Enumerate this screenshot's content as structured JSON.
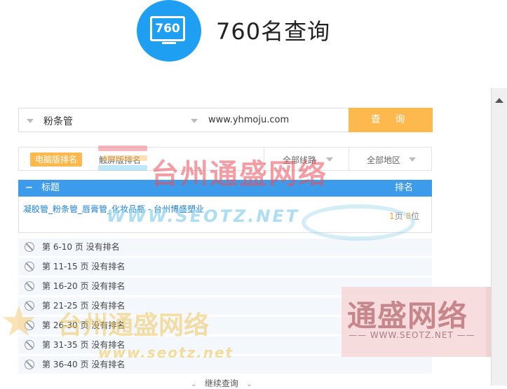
{
  "header": {
    "logo_text": "760",
    "title": "760名查询"
  },
  "search": {
    "keyword": "粉条管",
    "site": "www.yhmoju.com",
    "button_label": "查 询"
  },
  "filters": {
    "pc_tab": "电脑版排名",
    "mobile_tab": "触屏版排名",
    "line_select": "全部线路",
    "region_select": "全部地区"
  },
  "table": {
    "col_title": "标题",
    "col_rank": "排名",
    "minus": "−"
  },
  "result": {
    "link_text": "凝胶管_粉条管_唇膏管_化妆品瓶 - 台州博盛塑业",
    "page_num": "1",
    "page_label": "页",
    "pos_num": "8",
    "pos_label": "位"
  },
  "no_rank_rows": [
    "第 6-10 页 没有排名",
    "第 11-15 页 没有排名",
    "第 16-20 页 没有排名",
    "第 21-25 页 没有排名",
    "第 26-30 页 没有排名",
    "第 31-35 页 没有排名",
    "第 36-40 页 没有排名"
  ],
  "continue_label": "继续查询",
  "watermarks": {
    "top_cn": "台州通盛网络",
    "top_url": "WWW.SEOTZ.NET",
    "box_cn": "通盛网络",
    "box_url": "—— WWW.SEOTZ.NET ——",
    "bottom_cn": "台州通盛网络",
    "bottom_url": "www.seotz.net"
  },
  "colors": {
    "accent_orange": "#fdb84e",
    "header_blue": "#3d9bec",
    "logo_blue": "#1e9ff2",
    "link_blue": "#1f82d4"
  }
}
